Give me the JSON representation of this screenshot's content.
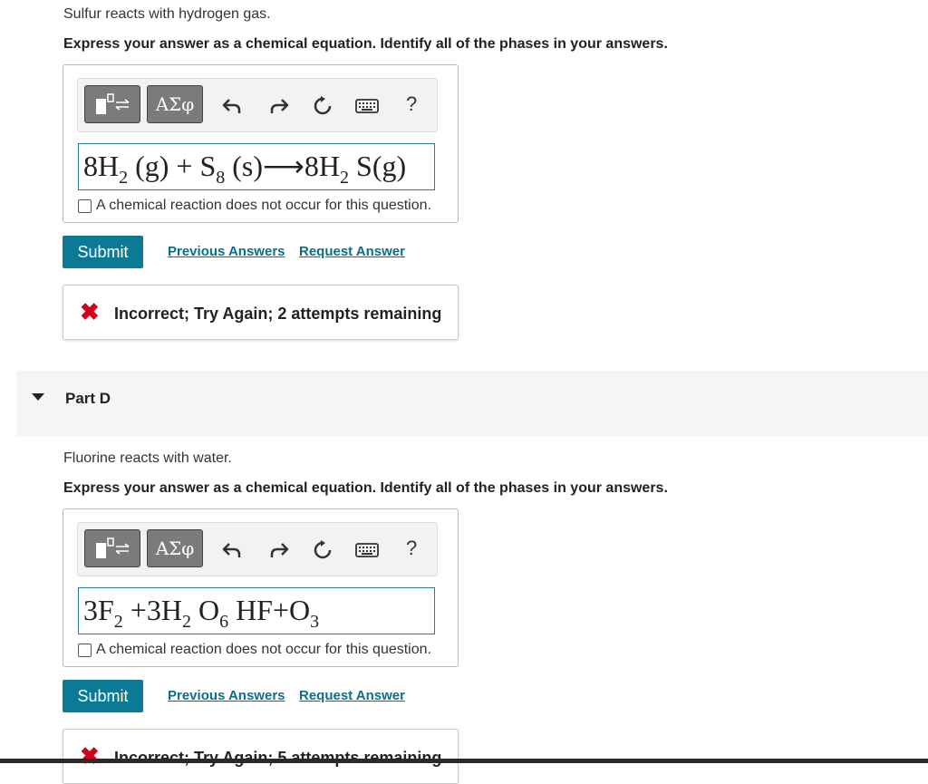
{
  "part_c": {
    "prompt": "Sulfur reacts with hydrogen gas.",
    "instruction": "Express your answer as a chemical equation. Identify all of the phases in your answers.",
    "toolbar": {
      "greek_label": "ΑΣφ",
      "help_label": "?"
    },
    "equation": {
      "t1": "8H",
      "s1": "2",
      "t2": " (g) + S",
      "s2": "8",
      "t3": " (s)⟶8H",
      "s3": "2",
      "t4": " S(g)"
    },
    "no_reaction_label": "A chemical reaction does not occur for this question.",
    "submit_label": "Submit",
    "previous_answers_label": "Previous Answers",
    "request_answer_label": "Request Answer",
    "feedback": "Incorrect; Try Again; 2 attempts remaining"
  },
  "part_d": {
    "header": "Part D",
    "prompt": "Fluorine reacts with water.",
    "instruction": "Express your answer as a chemical equation. Identify all of the phases in your answers.",
    "toolbar": {
      "greek_label": "ΑΣφ",
      "help_label": "?"
    },
    "equation": {
      "t1": "3F",
      "s1": "2",
      "t2": " +3H",
      "s2": "2",
      "t3": " O",
      "s3": "6",
      "t4": " HF+O",
      "s4": "3"
    },
    "no_reaction_label": "A chemical reaction does not occur for this question.",
    "submit_label": "Submit",
    "previous_answers_label": "Previous Answers",
    "request_answer_label": "Request Answer",
    "feedback": "Incorrect; Try Again; 5 attempts remaining"
  },
  "colors": {
    "accent": "#0b7a94",
    "error": "#d0021b",
    "link": "#0b6e8a"
  }
}
